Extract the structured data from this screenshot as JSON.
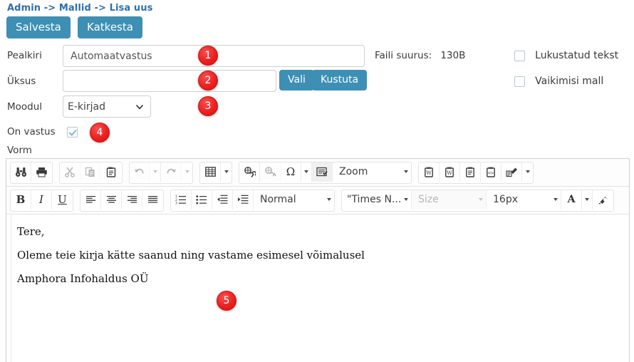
{
  "breadcrumb": "Admin -> Mallid -> Lisa uus",
  "actions": {
    "save_label": "Salvesta",
    "cancel_label": "Katkesta"
  },
  "form": {
    "title_label": "Pealkiri",
    "title_value": "Automaatvastus",
    "unit_label": "Üksus",
    "unit_value": "",
    "unit_select_label": "Vali",
    "unit_delete_label": "Kustuta",
    "module_label": "Moodul",
    "module_value": "E-kirjad",
    "module_options": [
      "E-kirjad"
    ],
    "is_reply_label": "On vastus",
    "is_reply_checked": true,
    "form_label": "Vorm",
    "filesize_label": "Faili suurus:",
    "filesize_value": "130B",
    "locked_text_label": "Lukustatud tekst",
    "locked_text_checked": false,
    "default_template_label": "Vaikimisi mall",
    "default_template_checked": false
  },
  "editor": {
    "toolbar_row1": {
      "find": "find-icon",
      "print": "print-icon",
      "cut": "cut-icon",
      "copy": "copy-icon",
      "paste": "paste-icon",
      "undo": "undo-icon",
      "redo": "redo-icon",
      "table": "table-icon",
      "link": "link-icon",
      "unlink": "unlink-icon",
      "special_char": "Ω",
      "page_break": "page-break-icon",
      "zoom_label": "Zoom",
      "paste_word": "paste-from-word-icon",
      "paste_word2": "paste-from-word-alt-icon",
      "paste_text": "paste-plain-text-icon",
      "paste_html": "paste-html-icon",
      "format_painter": "format-painter-icon"
    },
    "toolbar_row2": {
      "bold": "B",
      "italic": "I",
      "underline": "U",
      "align_left": "align-left-icon",
      "align_center": "align-center-icon",
      "align_right": "align-right-icon",
      "align_justify": "align-justify-icon",
      "numbered_list": "numbered-list-icon",
      "bulleted_list": "bulleted-list-icon",
      "outdent": "decrease-indent-icon",
      "indent": "increase-indent-icon",
      "paragraph_format": "Normal",
      "font_family": "\"Times N...",
      "font_size_placeholder": "Size",
      "font_size_px": "16px",
      "text_color": "A",
      "highlight_color": "highlight-icon"
    },
    "content": [
      "Tere,",
      "Oleme teie kirja kätte saanud ning vastame esimesel võimalusel",
      "Amphora Infohaldus OÜ"
    ]
  },
  "annotations": [
    {
      "number": "1"
    },
    {
      "number": "2"
    },
    {
      "number": "3"
    },
    {
      "number": "4"
    },
    {
      "number": "5"
    }
  ],
  "colors": {
    "brand_button": "#3d8fb3",
    "breadcrumb_link": "#2f6fa8",
    "badge_red": "#ec2020"
  }
}
